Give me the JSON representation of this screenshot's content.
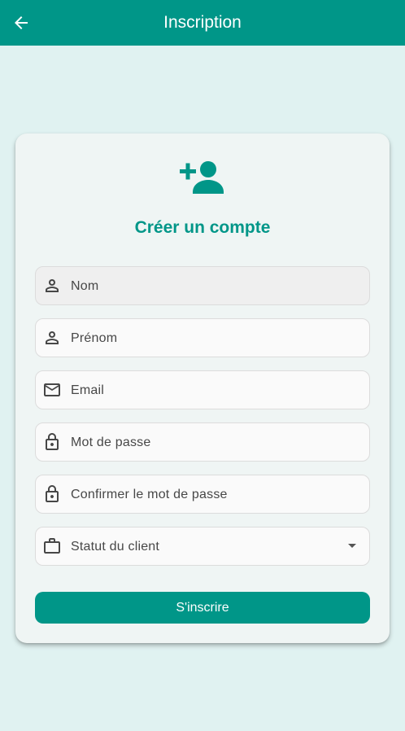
{
  "appbar": {
    "title": "Inscription",
    "back_icon": "arrow-back-icon",
    "color": "#009688"
  },
  "card": {
    "header_icon": "person-add-icon",
    "title": "Créer un compte",
    "fields": [
      {
        "label": "Nom",
        "icon": "person-icon"
      },
      {
        "label": "Prénom",
        "icon": "person-icon"
      },
      {
        "label": "Email",
        "icon": "mail-icon"
      },
      {
        "label": "Mot de passe",
        "icon": "lock-icon"
      },
      {
        "label": "Confirmer le mot de passe",
        "icon": "lock-icon"
      },
      {
        "label": "Statut du client",
        "icon": "briefcase-icon",
        "dropdown_icon": "chevron-down-icon"
      }
    ],
    "submit_label": "S'inscrire"
  },
  "colors": {
    "primary": "#009688",
    "background": "#e0f2f1",
    "card": "#eff5f4"
  }
}
